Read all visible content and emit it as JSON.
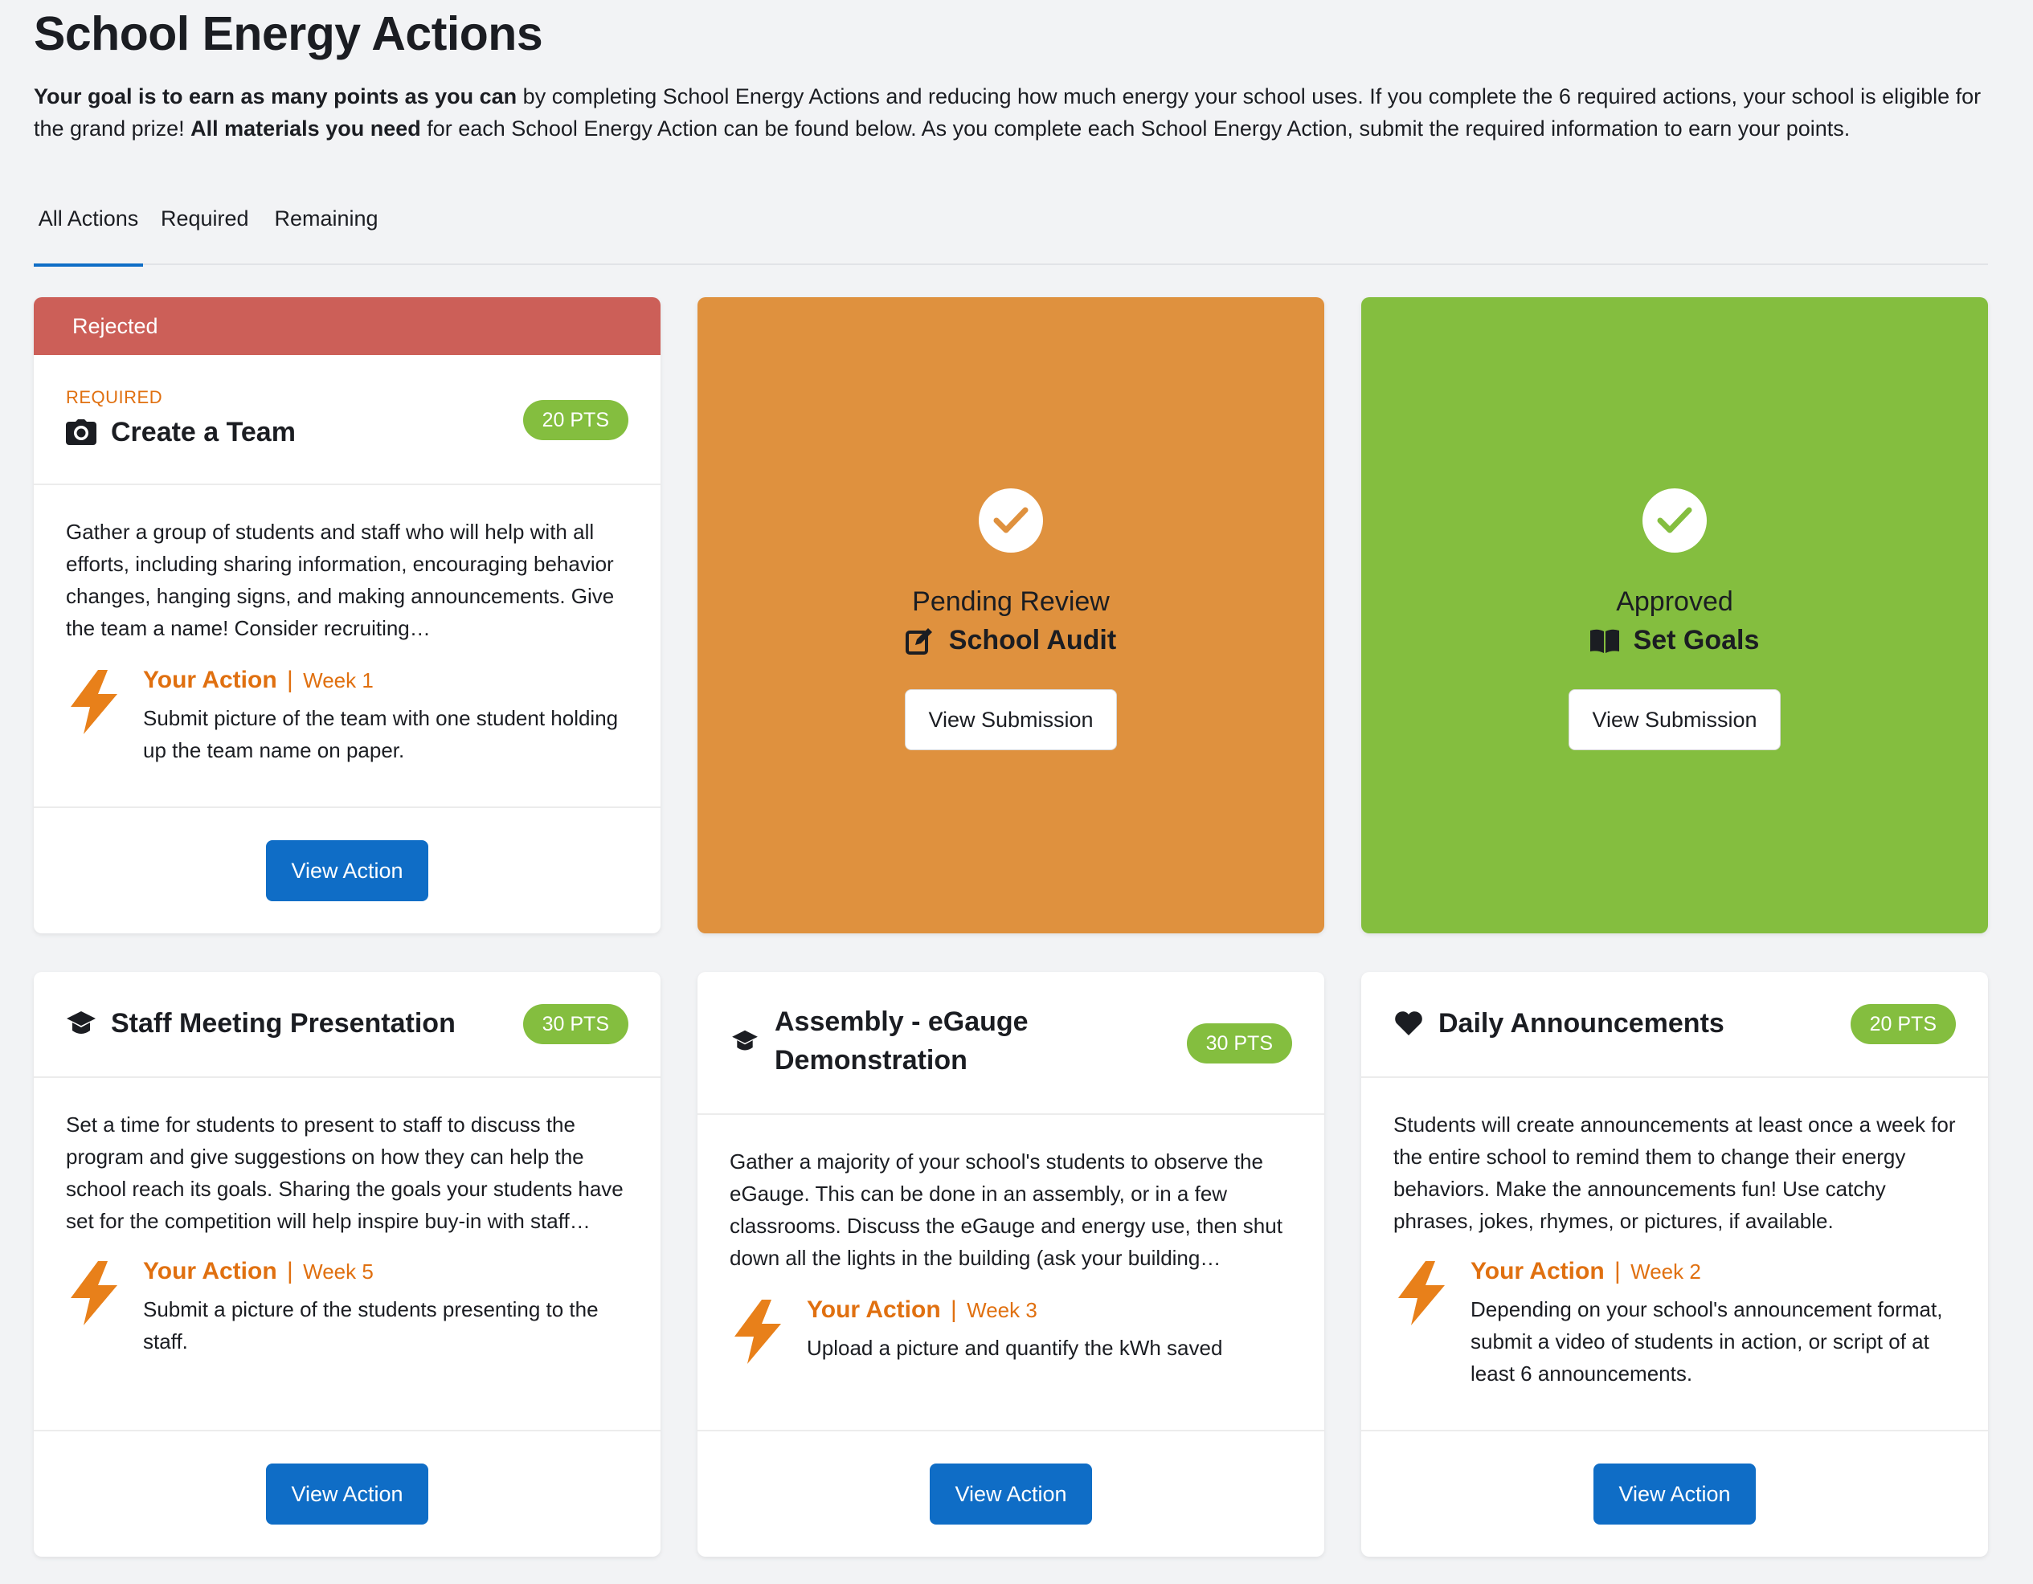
{
  "page": {
    "title": "School Energy Actions",
    "intro_bold1": "Your goal is to earn as many points as you can",
    "intro_text1": " by completing School Energy Actions and reducing how much energy your school uses. If you complete the 6 required actions, your school is eligible for the grand prize! ",
    "intro_bold2": "All materials you need",
    "intro_text2": " for each School Energy Action can be found below. As you complete each School Energy Action, submit the required information to earn your points."
  },
  "tabs": [
    {
      "label": "All Actions",
      "active": true
    },
    {
      "label": "Required",
      "active": false
    },
    {
      "label": "Remaining",
      "active": false
    }
  ],
  "colors": {
    "accent_blue": "#0f6dc6",
    "rejected_red": "#cc5f58",
    "pending_orange": "#df913e",
    "approved_green": "#84be3f",
    "action_orange": "#e07010"
  },
  "cards": {
    "create_team": {
      "banner": "Rejected",
      "required_label": "REQUIRED",
      "icon": "camera-icon",
      "title": "Create a Team",
      "points": "20 PTS",
      "description": "Gather a group of students and staff who will help with all efforts, including sharing information, encouraging behavior changes, hanging signs, and making announcements. Give the team a name! Consider recruiting…",
      "action_label": "Your Action",
      "action_sep": "|",
      "action_week": "Week 1",
      "action_text": "Submit picture of the team with one student holding up the team name on paper.",
      "button": "View Action"
    },
    "school_audit": {
      "status": "Pending Review",
      "icon": "edit-icon",
      "title": "School Audit",
      "button": "View Submission"
    },
    "set_goals": {
      "status": "Approved",
      "icon": "book-icon",
      "title": "Set Goals",
      "button": "View Submission"
    },
    "staff_meeting": {
      "icon": "graduation-cap-icon",
      "title": "Staff Meeting Presentation",
      "points": "30 PTS",
      "description": "Set a time for students to present to staff to discuss the program and give suggestions on how they can help the school reach its goals. Sharing the goals your students have set for the competition will help inspire buy-in with staff…",
      "action_label": "Your Action",
      "action_sep": "|",
      "action_week": "Week 5",
      "action_text": "Submit a picture of the students presenting to the staff.",
      "button": "View Action"
    },
    "assembly": {
      "icon": "graduation-cap-icon",
      "title_line1": "Assembly - eGauge",
      "title_line2": "Demonstration",
      "points": "30 PTS",
      "description": "Gather a majority of your school's students to observe the eGauge. This can be done in an assembly, or in a few classrooms. Discuss the eGauge and energy use, then shut down all the lights in the building (ask your building…",
      "action_label": "Your Action",
      "action_sep": "|",
      "action_week": "Week 3",
      "action_text": "Upload a picture and quantify the kWh saved",
      "button": "View Action"
    },
    "announcements": {
      "icon": "heart-icon",
      "title": "Daily Announcements",
      "points": "20 PTS",
      "description": "Students will create announcements at least once a week for the entire school to remind them to change their energy behaviors. Make the announcements fun! Use catchy phrases, jokes, rhymes, or pictures, if available.",
      "action_label": "Your Action",
      "action_sep": "|",
      "action_week": "Week 2",
      "action_text": "Depending on your school's announcement format, submit a video of students in action, or script of at least 6 announcements.",
      "button": "View Action"
    }
  }
}
